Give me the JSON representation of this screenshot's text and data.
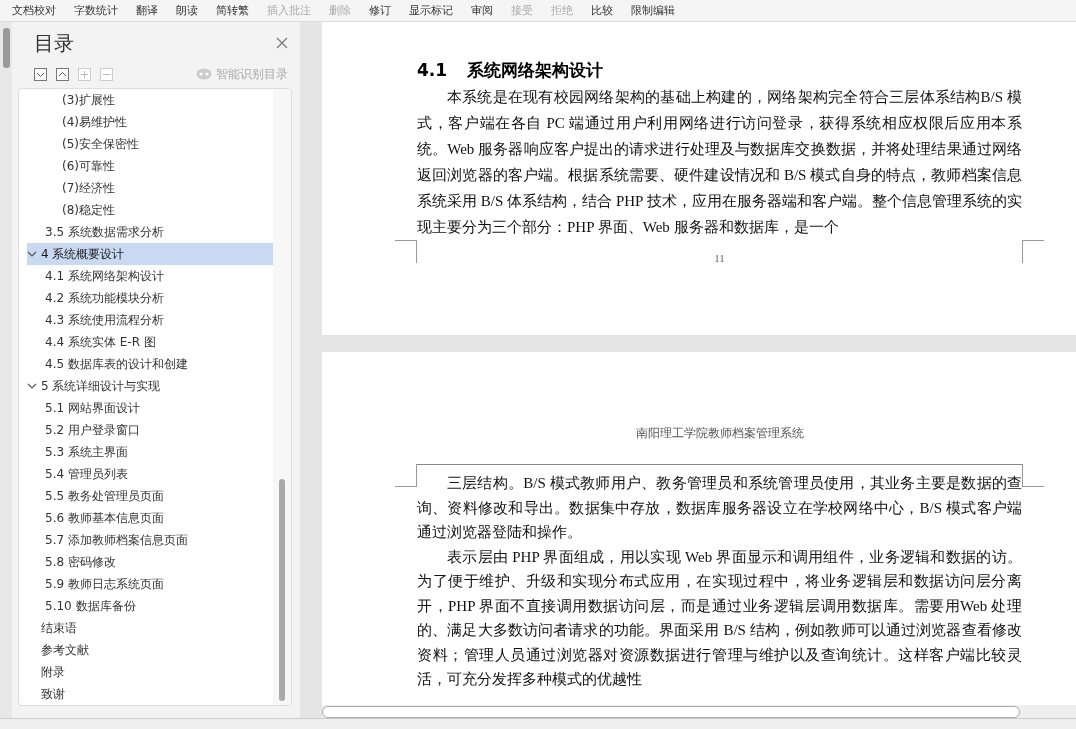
{
  "toolbar": {
    "items": [
      {
        "label": "文档校对",
        "disabled": false
      },
      {
        "label": "字数统计",
        "disabled": false
      },
      {
        "label": "翻译",
        "disabled": false
      },
      {
        "label": "朗读",
        "disabled": false
      },
      {
        "label": "简转繁",
        "disabled": false
      },
      {
        "label": "插入批注",
        "disabled": true
      },
      {
        "label": "删除",
        "disabled": true
      },
      {
        "label": "修订",
        "disabled": false
      },
      {
        "label": "显示标记",
        "disabled": false
      },
      {
        "label": "审阅",
        "disabled": false
      },
      {
        "label": "接受",
        "disabled": true
      },
      {
        "label": "拒绝",
        "disabled": true
      },
      {
        "label": "比较",
        "disabled": false
      },
      {
        "label": "限制编辑",
        "disabled": false
      }
    ]
  },
  "sidebar": {
    "title": "目录",
    "smart_button": "智能识别目录",
    "toc": [
      {
        "children": [
          {
            "children": [
              {
                "label": "(3)扩展性",
                "selected": false
              },
              {
                "label": "(4)易维护性",
                "selected": false
              },
              {
                "label": "(5)安全保密性",
                "selected": false
              },
              {
                "label": "(6)可靠性",
                "selected": false
              },
              {
                "label": "(7)经济性",
                "selected": false
              },
              {
                "label": "(8)稳定性",
                "selected": false
              }
            ]
          },
          {
            "label": "3.5  系统数据需求分析",
            "selected": false
          }
        ]
      },
      {
        "label": "4  系统概要设计",
        "selected": true,
        "expanded": true,
        "children": [
          {
            "label": "4.1  系统网络架构设计",
            "selected": false
          },
          {
            "label": "4.2  系统功能模块分析",
            "selected": false
          },
          {
            "label": "4.3  系统使用流程分析",
            "selected": false
          },
          {
            "label": "4.4  系统实体 E-R 图",
            "selected": false
          },
          {
            "label": "4.5  数据库表的设计和创建",
            "selected": false
          }
        ]
      },
      {
        "label": "5  系统详细设计与实现",
        "selected": false,
        "expanded": true,
        "children": [
          {
            "label": "5.1  网站界面设计",
            "selected": false
          },
          {
            "label": "5.2  用户登录窗口",
            "selected": false
          },
          {
            "label": "5.3  系统主界面",
            "selected": false
          },
          {
            "label": "5.4  管理员列表",
            "selected": false
          },
          {
            "label": "5.5  教务处管理员页面",
            "selected": false
          },
          {
            "label": "5.6  教师基本信息页面",
            "selected": false
          },
          {
            "label": "5.7  添加教师档案信息页面",
            "selected": false
          },
          {
            "label": "5.8  密码修改",
            "selected": false
          },
          {
            "label": "5.9  教师日志系统页面",
            "selected": false
          },
          {
            "label": "5.10  数据库备份",
            "selected": false
          }
        ]
      },
      {
        "label": "结束语",
        "selected": false
      },
      {
        "label": "参考文献",
        "selected": false
      },
      {
        "label": "附录",
        "selected": false
      },
      {
        "label": "致谢",
        "selected": false
      }
    ]
  },
  "pages": [
    {
      "heading_number": "4.1",
      "heading": "系统网络架构设计",
      "paragraphs": [
        "本系统是在现有校园网络架构的基础上构建的，网络架构完全符合三层体系结构B/S 模式，客户端在各自 PC 端通过用户利用网络进行访问登录，获得系统相应权限后应用本系统。Web 服务器响应客户提出的请求进行处理及与数据库交换数据，并将处理结果通过网络返回浏览器的客户端。根据系统需要、硬件建设情况和 B/S 模式自身的特点，教师档案信息系统采用 B/S 体系结构，结合 PHP 技术，应用在服务器端和客户端。整个信息管理系统的实现主要分为三个部分：PHP 界面、Web 服务器和数据库，是一个"
      ],
      "page_number": "11"
    },
    {
      "header": "南阳理工学院教师档案管理系统",
      "paragraphs": [
        "三层结构。B/S 模式教师用户、教务管理员和系统管理员使用，其业务主要是数据的查询、资料修改和导出。数据集中存放，数据库服务器设立在学校网络中心，B/S 模式客户端通过浏览器登陆和操作。",
        "表示层由 PHP 界面组成，用以实现 Web 界面显示和调用组件，业务逻辑和数据的访。为了便于维护、升级和实现分布式应用，在实现过程中，将业务逻辑层和数据访问层分离开，PHP 界面不直接调用数据访问层，而是通过业务逻辑层调用数据库。需要用Web 处理的、满足大多数访问者请求的功能。界面采用 B/S 结构，例如教师可以通过浏览器查看修改资料；管理人员通过浏览器对资源数据进行管理与维护以及查询统计。这样客户端比较灵活，可充分发挥多种模式的优越性"
      ]
    }
  ]
}
